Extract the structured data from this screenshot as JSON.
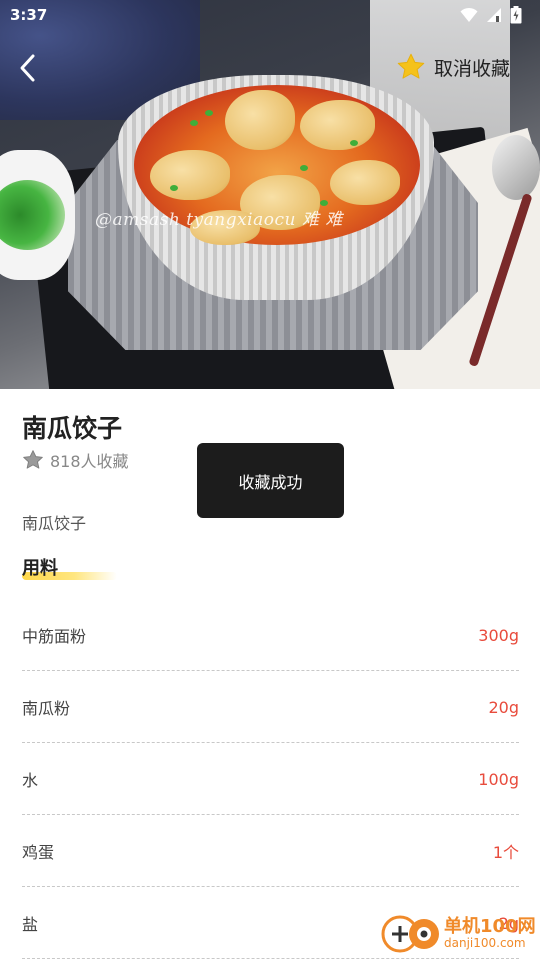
{
  "status_bar": {
    "time": "3:37"
  },
  "nav": {
    "back_icon": "chevron-left-icon",
    "unfavorite_label": "取消收藏",
    "star_icon": "star-icon",
    "star_color": "#f5c21b"
  },
  "hero": {
    "watermark": "@amsash tyangxiaocu 难 难"
  },
  "recipe": {
    "title": "南瓜饺子",
    "favorite_count": "818人收藏",
    "description": "南瓜饺子"
  },
  "ingredients_section": {
    "title": "用料",
    "items": [
      {
        "name": "中筋面粉",
        "amount": "300g"
      },
      {
        "name": "南瓜粉",
        "amount": "20g"
      },
      {
        "name": "水",
        "amount": "100g"
      },
      {
        "name": "鸡蛋",
        "amount": "1个"
      },
      {
        "name": "盐",
        "amount": "2g"
      }
    ]
  },
  "toast": {
    "message": "收藏成功"
  },
  "watermark_logo": {
    "name": "单机100网",
    "url": "danji100.com"
  },
  "colors": {
    "accent_red": "#e84b3c",
    "highlight_yellow": "#ffd84a",
    "toast_bg": "#1c1c1c"
  }
}
